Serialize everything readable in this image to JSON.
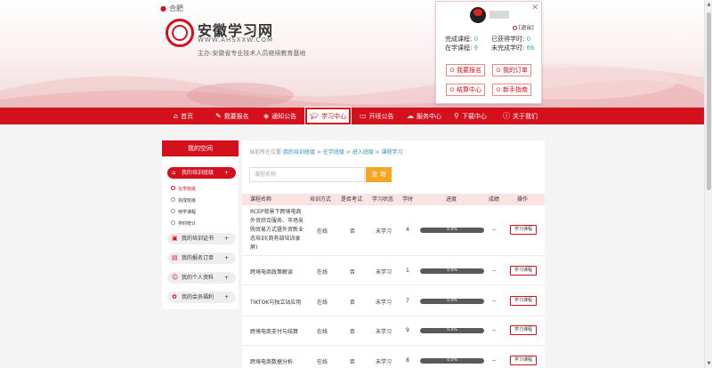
{
  "header": {
    "location": "合肥",
    "site_name": "安徽学习网",
    "site_url": "WWW.AHSXXW.COM",
    "sponsor": "主办:安徽省专业技术人员继续教育基地"
  },
  "user_panel": {
    "logout": "[退出]",
    "stats": [
      {
        "label": "完成课程:",
        "value": "0"
      },
      {
        "label": "已获得学时:",
        "value": "0"
      },
      {
        "label": "在学课程:",
        "value": "9"
      },
      {
        "label": "未完成学时:",
        "value": "66"
      }
    ],
    "buttons": [
      "我要报名",
      "我的订单",
      "结算中心",
      "新手指南"
    ]
  },
  "nav": {
    "items": [
      "首页",
      "我要报名",
      "通知公告",
      "学习中心",
      "开班公告",
      "服务中心",
      "下载中心",
      "关于我们"
    ],
    "active_index": 3
  },
  "sidebar": {
    "title": "我的空间",
    "items": [
      "我的培训班级",
      "我的培训证书",
      "我的报名订单",
      "我的个人资料",
      "我的会员福利"
    ],
    "sub_items": [
      "在学班级",
      "完成班级",
      "待学课程",
      "学时统计"
    ],
    "plus": "+"
  },
  "main": {
    "breadcrumb_prefix": "当前所在位置:",
    "breadcrumb_path": "我的培训班级 > 在学班级 > 进入班级 > 课程学习",
    "search_placeholder": "课程名称",
    "search_button": "查 询",
    "columns": [
      "课程名称",
      "培训方式",
      "是否考试",
      "学习状态",
      "学时",
      "进度",
      "成绩",
      "操作"
    ],
    "rows": [
      {
        "name": "RCEP背景下跨境电商外贸综合服务、市场采购贸易方式暨外贸新业态培训(商务部培训录屏)",
        "mode": "在线",
        "exam": "否",
        "status": "未学习",
        "hours": "4",
        "progress": "0.0%",
        "score": "--",
        "action": "学习课程"
      },
      {
        "name": "跨境电商政策解读",
        "mode": "在线",
        "exam": "否",
        "status": "未学习",
        "hours": "1",
        "progress": "0.0%",
        "score": "--",
        "action": "学习课程"
      },
      {
        "name": "TIKTOK与独立站应用",
        "mode": "在线",
        "exam": "否",
        "status": "未学习",
        "hours": "7",
        "progress": "0.0%",
        "score": "--",
        "action": "学习课程"
      },
      {
        "name": "跨境电商支付与结算",
        "mode": "在线",
        "exam": "否",
        "status": "未学习",
        "hours": "9",
        "progress": "0.0%",
        "score": "--",
        "action": "学习课程"
      },
      {
        "name": "跨境电商数据分析",
        "mode": "在线",
        "exam": "否",
        "status": "未学习",
        "hours": "8",
        "progress": "0.0%",
        "score": "--",
        "action": "学习课程"
      }
    ]
  },
  "colors": {
    "brand_red": "#d4101d",
    "search_orange": "#f5a623",
    "stat_teal": "#2bb3b3",
    "link_blue": "#2a8fbd"
  }
}
